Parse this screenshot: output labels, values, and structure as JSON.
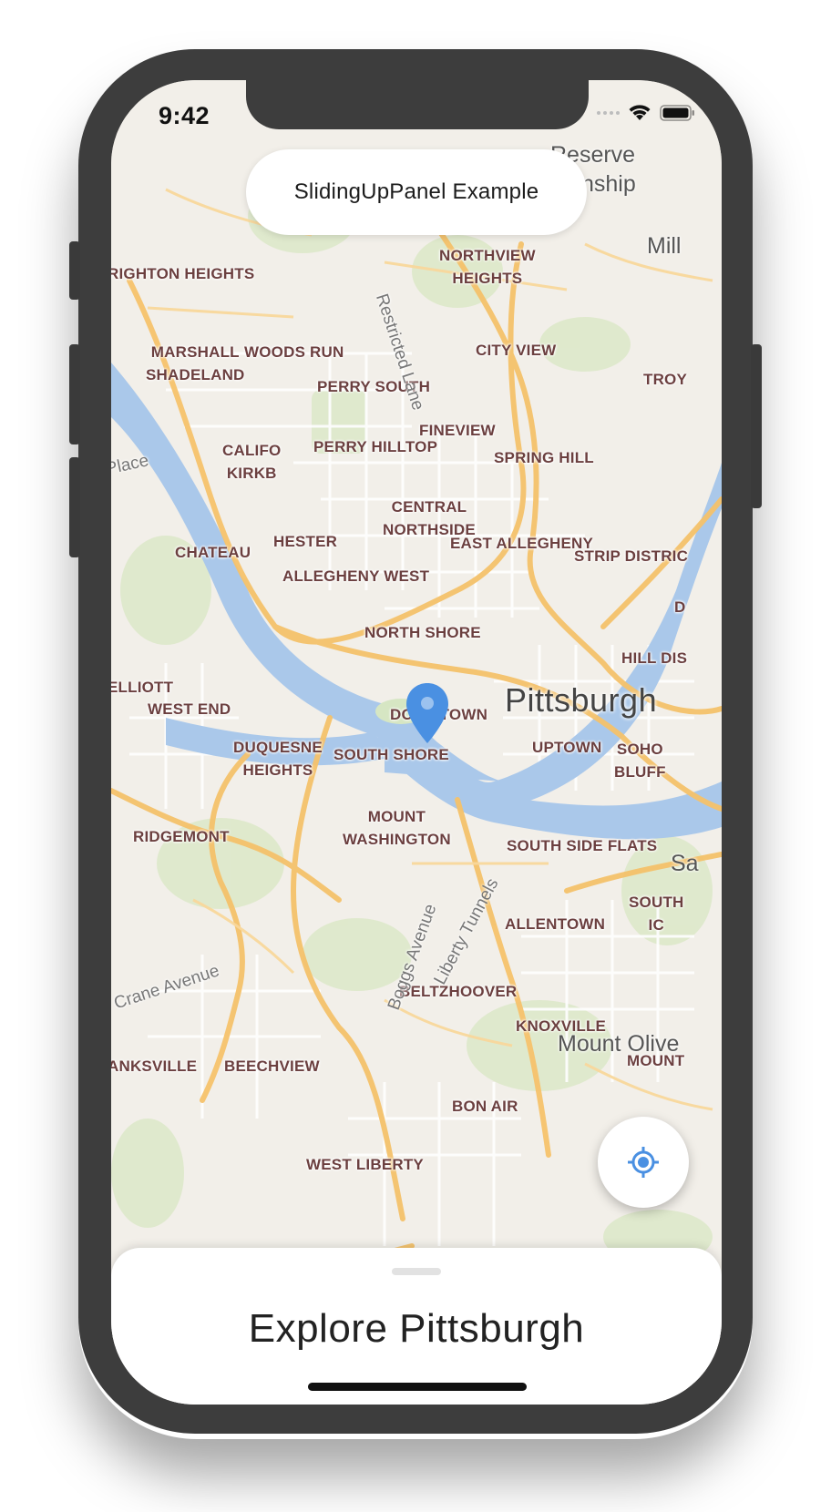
{
  "status_bar": {
    "time": "9:42"
  },
  "app_bar": {
    "title": "SlidingUpPanel Example"
  },
  "map": {
    "city": "Pittsburgh",
    "neighborhoods": [
      "RIGHTON HEIGHTS",
      "NORTHVIEW\nHEIGHTS",
      "MARSHALL\nSHADELAND",
      "WOODS RUN",
      "CITY VIEW",
      "TROY",
      "PERRY SOUTH",
      "FINEVIEW",
      "CALIFO\nKIRKB",
      "PERRY HILLTOP",
      "SPRING HILL",
      "CENTRAL\nNORTHSIDE",
      "CHATEAU",
      "HESTER",
      "EAST ALLEGHENY",
      "STRIP DISTRIC",
      "ALLEGHENY WEST",
      "NORTH SHORE",
      "HILL DIS",
      "ELLIOTT",
      "WEST END",
      "DOWNTOWN",
      "DUQUESNE\nHEIGHTS",
      "SOUTH SHORE",
      "UPTOWN",
      "SOHO\nBLUFF",
      "MOUNT\nWASHINGTON",
      "RIDGEMONT",
      "SOUTH SIDE FLATS",
      "SOUTH\nIC",
      "ALLENTOWN",
      "BELTZHOOVER",
      "KNOXVILLE",
      "MOUNT",
      "ANKSVILLE",
      "BEECHVIEW",
      "BON AIR",
      "WEST LIBERTY",
      "D"
    ],
    "roads": [
      "Restricted Lane",
      "Place",
      "Boggs Avenue",
      "Liberty Tunnels",
      "Crane Avenue"
    ],
    "suburbs": [
      "Reserve",
      "ownship",
      "Mill",
      "Mount Olive",
      "Sa"
    ]
  },
  "locate_button": {
    "icon": "my-location-icon"
  },
  "panel": {
    "title": "Explore Pittsburgh"
  },
  "colors": {
    "accent": "#4a90e2",
    "river": "#aac8ea",
    "water_dark": "#9cbfe6",
    "road_major": "#f5c26b",
    "park": "#d6e6c3"
  }
}
